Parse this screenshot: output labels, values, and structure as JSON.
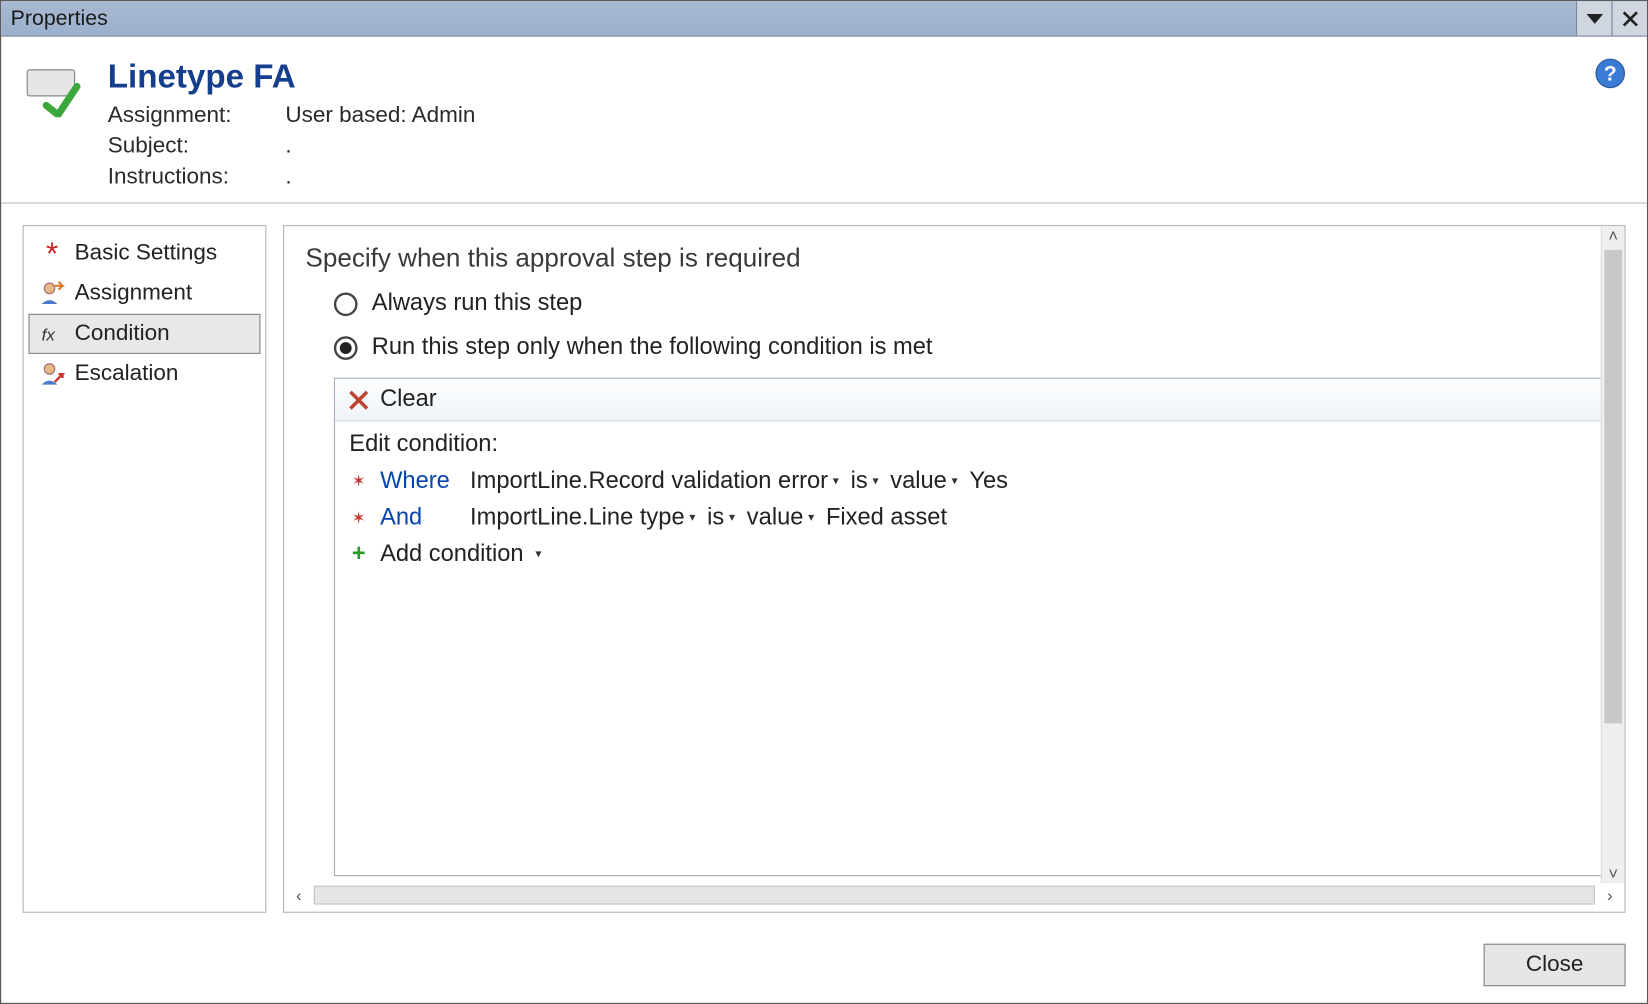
{
  "titlebar": {
    "title": "Properties"
  },
  "header": {
    "title": "Linetype FA",
    "fields": {
      "assignment_label": "Assignment:",
      "assignment_value": "User based: Admin",
      "subject_label": "Subject:",
      "subject_value": ".",
      "instructions_label": "Instructions:",
      "instructions_value": "."
    }
  },
  "sidebar": {
    "items": [
      {
        "label": "Basic Settings",
        "icon": "asterisk"
      },
      {
        "label": "Assignment",
        "icon": "person-assign"
      },
      {
        "label": "Condition",
        "icon": "fx"
      },
      {
        "label": "Escalation",
        "icon": "person-escalate"
      }
    ],
    "selected_index": 2
  },
  "main": {
    "heading": "Specify when this approval step is required",
    "radio": {
      "always": "Always run this step",
      "conditional": "Run this step only when the following condition is met",
      "selected": "conditional"
    },
    "toolbar": {
      "clear": "Clear"
    },
    "edit_label": "Edit condition:",
    "rows": [
      {
        "keyword": "Where",
        "field": "ImportLine.Record validation error",
        "op": "is",
        "valkw": "value",
        "val": "Yes"
      },
      {
        "keyword": "And",
        "field": "ImportLine.Line type",
        "op": "is",
        "valkw": "value",
        "val": "Fixed asset"
      }
    ],
    "add_label": "Add condition"
  },
  "footer": {
    "close": "Close"
  }
}
